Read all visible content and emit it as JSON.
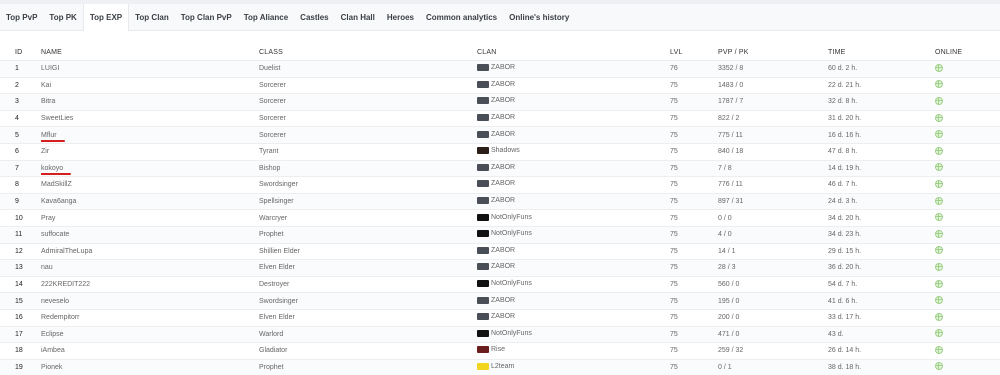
{
  "tabs": [
    {
      "label": "Top PvP",
      "active": false
    },
    {
      "label": "Top PK",
      "active": false
    },
    {
      "label": "Top EXP",
      "active": true
    },
    {
      "label": "Top Clan",
      "active": false
    },
    {
      "label": "Top Clan PvP",
      "active": false
    },
    {
      "label": "Top Aliance",
      "active": false
    },
    {
      "label": "Castles",
      "active": false
    },
    {
      "label": "Clan Hall",
      "active": false
    },
    {
      "label": "Heroes",
      "active": false
    },
    {
      "label": "Common analytics",
      "active": false
    },
    {
      "label": "Online's history",
      "active": false
    }
  ],
  "table": {
    "headers": {
      "id": "ID",
      "name": "NAME",
      "class": "CLASS",
      "clan": "CLAN",
      "lvl": "LVL",
      "pvp_pk": "PVP / PK",
      "time": "TIME",
      "online": "ONLINE"
    },
    "rows": [
      {
        "id": "1",
        "name": "LUIGI",
        "class": "Duelist",
        "clan": "ZABOR",
        "crest": "zabor",
        "lvl": "76",
        "pvp_pk": "3352 / 8",
        "time": "60 d. 2 h.",
        "underlined": false
      },
      {
        "id": "2",
        "name": "Kai",
        "class": "Sorcerer",
        "clan": "ZABOR",
        "crest": "zabor",
        "lvl": "75",
        "pvp_pk": "1483 / 0",
        "time": "22 d. 21 h.",
        "underlined": false
      },
      {
        "id": "3",
        "name": "Bitra",
        "class": "Sorcerer",
        "clan": "ZABOR",
        "crest": "zabor",
        "lvl": "75",
        "pvp_pk": "1787 / 7",
        "time": "32 d. 8 h.",
        "underlined": false
      },
      {
        "id": "4",
        "name": "SweetLies",
        "class": "Sorcerer",
        "clan": "ZABOR",
        "crest": "zabor",
        "lvl": "75",
        "pvp_pk": "822 / 2",
        "time": "31 d. 20 h.",
        "underlined": false
      },
      {
        "id": "5",
        "name": "Mflur",
        "class": "Sorcerer",
        "clan": "ZABOR",
        "crest": "zabor",
        "lvl": "75",
        "pvp_pk": "775 / 11",
        "time": "16 d. 16 h.",
        "underlined": true
      },
      {
        "id": "6",
        "name": "Zir",
        "class": "Tyrant",
        "clan": "Shadows",
        "crest": "shadows",
        "lvl": "75",
        "pvp_pk": "840 / 18",
        "time": "47 d. 8 h.",
        "underlined": false
      },
      {
        "id": "7",
        "name": "kokoyo",
        "class": "Bishop",
        "clan": "ZABOR",
        "crest": "zabor",
        "lvl": "75",
        "pvp_pk": "7 / 8",
        "time": "14 d. 19 h.",
        "underlined": true
      },
      {
        "id": "8",
        "name": "MadSkillZ",
        "class": "Swordsinger",
        "clan": "ZABOR",
        "crest": "zabor",
        "lvl": "75",
        "pvp_pk": "776 / 11",
        "time": "46 d. 7 h.",
        "underlined": false
      },
      {
        "id": "9",
        "name": "Kava6anga",
        "class": "Spellsinger",
        "clan": "ZABOR",
        "crest": "zabor",
        "lvl": "75",
        "pvp_pk": "897 / 31",
        "time": "24 d. 3 h.",
        "underlined": false
      },
      {
        "id": "10",
        "name": "Pray",
        "class": "Warcryer",
        "clan": "NotOnlyFuns",
        "crest": "notonly",
        "lvl": "75",
        "pvp_pk": "0 / 0",
        "time": "34 d. 20 h.",
        "underlined": false
      },
      {
        "id": "11",
        "name": "suffocate",
        "class": "Prophet",
        "clan": "NotOnlyFuns",
        "crest": "notonly",
        "lvl": "75",
        "pvp_pk": "4 / 0",
        "time": "34 d. 23 h.",
        "underlined": false
      },
      {
        "id": "12",
        "name": "AdmiralTheLupa",
        "class": "Shillien Elder",
        "clan": "ZABOR",
        "crest": "zabor",
        "lvl": "75",
        "pvp_pk": "14 / 1",
        "time": "29 d. 15 h.",
        "underlined": false
      },
      {
        "id": "13",
        "name": "nau",
        "class": "Elven Elder",
        "clan": "ZABOR",
        "crest": "zabor",
        "lvl": "75",
        "pvp_pk": "28 / 3",
        "time": "36 d. 20 h.",
        "underlined": false
      },
      {
        "id": "14",
        "name": "222KREDIT222",
        "class": "Destroyer",
        "clan": "NotOnlyFuns",
        "crest": "notonly",
        "lvl": "75",
        "pvp_pk": "560 / 0",
        "time": "54 d. 7 h.",
        "underlined": false
      },
      {
        "id": "15",
        "name": "neveselo",
        "class": "Swordsinger",
        "clan": "ZABOR",
        "crest": "zabor",
        "lvl": "75",
        "pvp_pk": "195 / 0",
        "time": "41 d. 6 h.",
        "underlined": false
      },
      {
        "id": "16",
        "name": "Redempitorr",
        "class": "Elven Elder",
        "clan": "ZABOR",
        "crest": "zabor",
        "lvl": "75",
        "pvp_pk": "200 / 0",
        "time": "33 d. 17 h.",
        "underlined": false
      },
      {
        "id": "17",
        "name": "Eclipse",
        "class": "Warlord",
        "clan": "NotOnlyFuns",
        "crest": "notonly",
        "lvl": "75",
        "pvp_pk": "471 / 0",
        "time": "43 d.",
        "underlined": false
      },
      {
        "id": "18",
        "name": "iAmbea",
        "class": "Gladiator",
        "clan": "Rise",
        "crest": "rise",
        "lvl": "75",
        "pvp_pk": "259 / 32",
        "time": "26 d. 14 h.",
        "underlined": false
      },
      {
        "id": "19",
        "name": "Pionek",
        "class": "Prophet",
        "clan": "L2team",
        "crest": "l2team",
        "lvl": "75",
        "pvp_pk": "0 / 1",
        "time": "38 d. 18 h.",
        "underlined": false
      }
    ]
  },
  "crest_colors": {
    "zabor": "#4a4f57",
    "shadows": "#2b1d18",
    "notonly": "#111111",
    "rise": "#6b1e1e",
    "l2team": "#f2d61e"
  },
  "icons": {
    "online": "globe-icon",
    "crest": "clan-crest-icon"
  },
  "colors": {
    "underline": "#d62020",
    "online": "#9fd08a"
  }
}
